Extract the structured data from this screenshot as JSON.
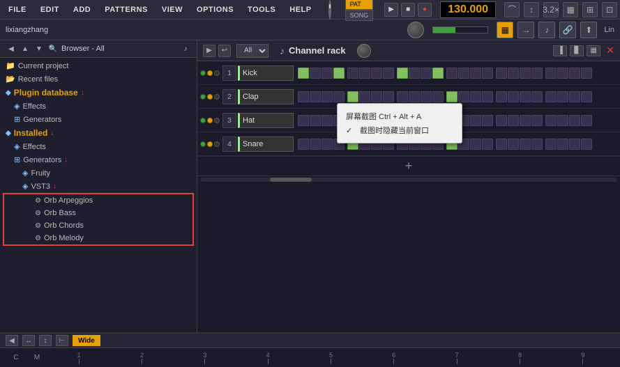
{
  "menubar": {
    "items": [
      "FILE",
      "EDIT",
      "ADD",
      "PATTERNS",
      "VIEW",
      "OPTIONS",
      "TOOLS",
      "HELP"
    ]
  },
  "transport": {
    "pat": "PAT",
    "song": "SONG",
    "play": "▶",
    "stop": "■",
    "record": "●",
    "bpm": "130.000"
  },
  "toolbar2": {
    "user": "lixiangzhang",
    "icons": [
      "grid",
      "arrow",
      "note",
      "link",
      "mixer"
    ]
  },
  "sidebar": {
    "header": "Browser - All",
    "items": [
      {
        "label": "Current project",
        "type": "folder",
        "indent": 0
      },
      {
        "label": "Recent files",
        "type": "folder",
        "indent": 0
      },
      {
        "label": "Plugin database",
        "type": "plugin",
        "indent": 0,
        "arrow": true
      },
      {
        "label": "Effects",
        "type": "fx",
        "indent": 1
      },
      {
        "label": "Generators",
        "type": "gen",
        "indent": 1
      },
      {
        "label": "Installed",
        "type": "plugin",
        "indent": 0,
        "arrow": true
      },
      {
        "label": "Effects",
        "type": "fx",
        "indent": 1
      },
      {
        "label": "Generators",
        "type": "gen",
        "indent": 1,
        "arrow": true
      },
      {
        "label": "Fruity",
        "type": "fx",
        "indent": 2
      },
      {
        "label": "VST3",
        "type": "fx",
        "indent": 2,
        "arrow": true
      }
    ],
    "redbox_items": [
      {
        "label": "Orb Arpeggios",
        "type": "gear"
      },
      {
        "label": "Orb Bass",
        "type": "gear"
      },
      {
        "label": "Orb Chords",
        "type": "gear"
      },
      {
        "label": "Orb Melody",
        "type": "gear"
      }
    ]
  },
  "channel_rack": {
    "title": "Channel rack",
    "filter": "All",
    "channels": [
      {
        "num": "1",
        "name": "Kick",
        "active_beats": [
          0,
          3,
          8,
          11
        ]
      },
      {
        "num": "2",
        "name": "Clap",
        "active_beats": [
          4,
          12
        ]
      },
      {
        "num": "3",
        "name": "Hat",
        "active_beats": []
      },
      {
        "num": "4",
        "name": "Snare",
        "active_beats": [
          4,
          12
        ]
      }
    ],
    "add_label": "+"
  },
  "tooltip": {
    "shortcut": "屏幕截图 Ctrl + Alt + A",
    "option": "截图时隐藏当前窗口",
    "checked": true
  },
  "bottom": {
    "wide_label": "Wide",
    "timeline_labels": [
      "C",
      "M",
      "1",
      "2",
      "3",
      "4",
      "5",
      "6",
      "7",
      "8",
      "9"
    ]
  }
}
